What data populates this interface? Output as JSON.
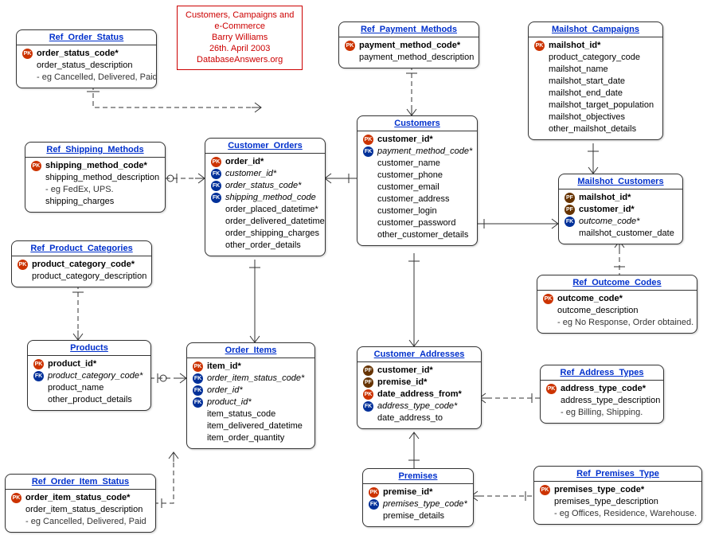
{
  "diagram_title": {
    "line1": "Customers, Campaigns and",
    "line2": "e-Commerce",
    "line3": "Barry Williams",
    "line4": "26th. April 2003",
    "line5": "DatabaseAnswers.org"
  },
  "entities": {
    "ref_order_status": {
      "title": "Ref_Order_Status",
      "attrs": [
        {
          "badge": "pk",
          "text": "order_status_code*",
          "style": "key"
        },
        {
          "badge": "none",
          "text": "order_status_description",
          "style": ""
        },
        {
          "badge": "none",
          "text": "- eg Cancelled, Delivered, Paid",
          "style": "note"
        }
      ]
    },
    "ref_payment_methods": {
      "title": "Ref_Payment_Methods",
      "attrs": [
        {
          "badge": "pk",
          "text": "payment_method_code*",
          "style": "key"
        },
        {
          "badge": "none",
          "text": "payment_method_description",
          "style": ""
        }
      ]
    },
    "mailshot_campaigns": {
      "title": "Mailshot_Campaigns",
      "attrs": [
        {
          "badge": "pk",
          "text": "mailshot_id*",
          "style": "key"
        },
        {
          "badge": "none",
          "text": "product_category_code",
          "style": ""
        },
        {
          "badge": "none",
          "text": "mailshot_name",
          "style": ""
        },
        {
          "badge": "none",
          "text": "mailshot_start_date",
          "style": ""
        },
        {
          "badge": "none",
          "text": "mailshot_end_date",
          "style": ""
        },
        {
          "badge": "none",
          "text": "mailshot_target_population",
          "style": ""
        },
        {
          "badge": "none",
          "text": "mailshot_objectives",
          "style": ""
        },
        {
          "badge": "none",
          "text": "other_mailshot_details",
          "style": ""
        }
      ]
    },
    "customers": {
      "title": "Customers",
      "attrs": [
        {
          "badge": "pk",
          "text": "customer_id*",
          "style": "key"
        },
        {
          "badge": "fk",
          "text": "payment_method_code*",
          "style": "fk"
        },
        {
          "badge": "none",
          "text": "customer_name",
          "style": ""
        },
        {
          "badge": "none",
          "text": "customer_phone",
          "style": ""
        },
        {
          "badge": "none",
          "text": "customer_email",
          "style": ""
        },
        {
          "badge": "none",
          "text": "customer_address",
          "style": ""
        },
        {
          "badge": "none",
          "text": "customer_login",
          "style": ""
        },
        {
          "badge": "none",
          "text": "customer_password",
          "style": ""
        },
        {
          "badge": "none",
          "text": "other_customer_details",
          "style": ""
        }
      ]
    },
    "ref_shipping_methods": {
      "title": "Ref_Shipping_Methods",
      "attrs": [
        {
          "badge": "pk",
          "text": "shipping_method_code*",
          "style": "key"
        },
        {
          "badge": "none",
          "text": "shipping_method_description",
          "style": ""
        },
        {
          "badge": "none",
          "text": "- eg FedEx, UPS.",
          "style": "note"
        },
        {
          "badge": "none",
          "text": "shipping_charges",
          "style": ""
        }
      ]
    },
    "customer_orders": {
      "title": "Customer_Orders",
      "attrs": [
        {
          "badge": "pk",
          "text": "order_id*",
          "style": "key"
        },
        {
          "badge": "fk",
          "text": "customer_id*",
          "style": "fk"
        },
        {
          "badge": "fk",
          "text": "order_status_code*",
          "style": "fk"
        },
        {
          "badge": "fk",
          "text": "shipping_method_code",
          "style": "fk"
        },
        {
          "badge": "none",
          "text": "order_placed_datetime*",
          "style": ""
        },
        {
          "badge": "none",
          "text": "order_delivered_datetime",
          "style": ""
        },
        {
          "badge": "none",
          "text": "order_shipping_charges",
          "style": ""
        },
        {
          "badge": "none",
          "text": "other_order_details",
          "style": ""
        }
      ]
    },
    "mailshot_customers": {
      "title": "Mailshot_Customers",
      "attrs": [
        {
          "badge": "pf",
          "text": "mailshot_id*",
          "style": "key"
        },
        {
          "badge": "pf",
          "text": "customer_id*",
          "style": "key"
        },
        {
          "badge": "fk",
          "text": "outcome_code*",
          "style": "fk"
        },
        {
          "badge": "none",
          "text": "mailshot_customer_date",
          "style": ""
        }
      ]
    },
    "ref_product_categories": {
      "title": "Ref_Product_Categories",
      "attrs": [
        {
          "badge": "pk",
          "text": "product_category_code*",
          "style": "key"
        },
        {
          "badge": "none",
          "text": "product_category_description",
          "style": ""
        }
      ]
    },
    "ref_outcome_codes": {
      "title": "Ref_Outcome_Codes",
      "attrs": [
        {
          "badge": "pk",
          "text": "outcome_code*",
          "style": "key"
        },
        {
          "badge": "none",
          "text": "outcome_description",
          "style": ""
        },
        {
          "badge": "none",
          "text": "- eg No Response, Order obtained.",
          "style": "note"
        }
      ]
    },
    "products": {
      "title": "Products",
      "attrs": [
        {
          "badge": "pk",
          "text": "product_id*",
          "style": "key"
        },
        {
          "badge": "fk",
          "text": "product_category_code*",
          "style": "fk"
        },
        {
          "badge": "none",
          "text": "product_name",
          "style": ""
        },
        {
          "badge": "none",
          "text": "other_product_details",
          "style": ""
        }
      ]
    },
    "order_items": {
      "title": "Order_Items",
      "attrs": [
        {
          "badge": "pk",
          "text": "item_id*",
          "style": "key"
        },
        {
          "badge": "fk",
          "text": "order_item_status_code*",
          "style": "fk"
        },
        {
          "badge": "fk",
          "text": "order_id*",
          "style": "fk"
        },
        {
          "badge": "fk",
          "text": "product_id*",
          "style": "fk"
        },
        {
          "badge": "none",
          "text": "item_status_code",
          "style": ""
        },
        {
          "badge": "none",
          "text": "item_delivered_datetime",
          "style": ""
        },
        {
          "badge": "none",
          "text": "item_order_quantity",
          "style": ""
        }
      ]
    },
    "customer_addresses": {
      "title": "Customer_Addresses",
      "attrs": [
        {
          "badge": "pf",
          "text": "customer_id*",
          "style": "key"
        },
        {
          "badge": "pf",
          "text": "premise_id*",
          "style": "key"
        },
        {
          "badge": "pk",
          "text": "date_address_from*",
          "style": "key"
        },
        {
          "badge": "fk",
          "text": "address_type_code*",
          "style": "fk"
        },
        {
          "badge": "none",
          "text": "date_address_to",
          "style": ""
        }
      ]
    },
    "ref_address_types": {
      "title": "Ref_Address_Types",
      "attrs": [
        {
          "badge": "pk",
          "text": "address_type_code*",
          "style": "key"
        },
        {
          "badge": "none",
          "text": "address_type_description",
          "style": ""
        },
        {
          "badge": "none",
          "text": "- eg Billing, Shipping.",
          "style": "note"
        }
      ]
    },
    "ref_order_item_status": {
      "title": "Ref_Order_Item_Status",
      "attrs": [
        {
          "badge": "pk",
          "text": "order_item_status_code*",
          "style": "key"
        },
        {
          "badge": "none",
          "text": "order_item_status_description",
          "style": ""
        },
        {
          "badge": "none",
          "text": "- eg Cancelled, Delivered, Paid",
          "style": "note"
        }
      ]
    },
    "premises": {
      "title": "Premises",
      "attrs": [
        {
          "badge": "pk",
          "text": "premise_id*",
          "style": "key"
        },
        {
          "badge": "fk",
          "text": "premises_type_code*",
          "style": "fk"
        },
        {
          "badge": "none",
          "text": "premise_details",
          "style": ""
        }
      ]
    },
    "ref_premises_type": {
      "title": "Ref_Premises_Type",
      "attrs": [
        {
          "badge": "pk",
          "text": "premises_type_code*",
          "style": "key"
        },
        {
          "badge": "none",
          "text": "premises_type_description",
          "style": ""
        },
        {
          "badge": "none",
          "text": "- eg Offices, Residence, Warehouse.",
          "style": "note"
        }
      ]
    }
  }
}
